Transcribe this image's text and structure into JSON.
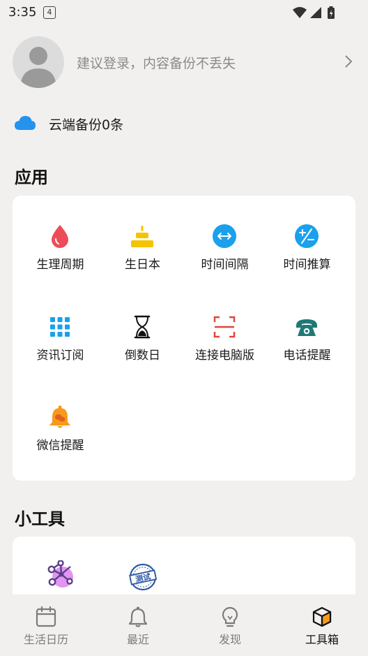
{
  "status_bar": {
    "time": "3:35",
    "badge": "4"
  },
  "login": {
    "prompt": "建议登录，内容备份不丢失"
  },
  "backup": {
    "text": "云端备份0条"
  },
  "apps_section": {
    "title": "应用",
    "items": [
      {
        "label": "生理周期",
        "icon": "blood-drop-icon"
      },
      {
        "label": "生日本",
        "icon": "birthday-cake-icon"
      },
      {
        "label": "时间间隔",
        "icon": "double-arrow-icon"
      },
      {
        "label": "时间推算",
        "icon": "plus-minus-icon"
      },
      {
        "label": "资讯订阅",
        "icon": "grid-dots-icon"
      },
      {
        "label": "倒数日",
        "icon": "hourglass-icon"
      },
      {
        "label": "连接电脑版",
        "icon": "scan-frame-icon"
      },
      {
        "label": "电话提醒",
        "icon": "telephone-icon"
      },
      {
        "label": "微信提醒",
        "icon": "bell-icon"
      }
    ]
  },
  "tools_section": {
    "title": "小工具",
    "items": [
      {
        "icon": "molecule-icon"
      },
      {
        "icon": "test-stamp-icon",
        "stamp_text": "测试"
      }
    ]
  },
  "tabbar": {
    "tabs": [
      {
        "label": "生活日历",
        "icon": "calendar-icon"
      },
      {
        "label": "最近",
        "icon": "bell-icon"
      },
      {
        "label": "发现",
        "icon": "lightbulb-icon"
      },
      {
        "label": "工具箱",
        "icon": "box-icon",
        "active": true
      }
    ]
  },
  "colors": {
    "background": "#f1f0ef",
    "card": "#ffffff",
    "blue": "#1aa0ec",
    "red": "#ee4b59",
    "yellow": "#f5c400",
    "orange": "#f79a1c",
    "teal": "#1f7a76"
  }
}
